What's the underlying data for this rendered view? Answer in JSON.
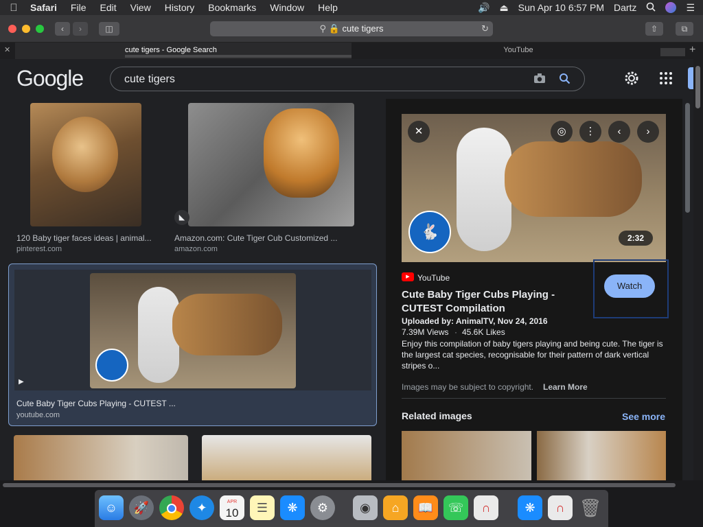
{
  "menubar": {
    "app": "Safari",
    "items": [
      "File",
      "Edit",
      "View",
      "History",
      "Bookmarks",
      "Window",
      "Help"
    ],
    "datetime": "Sun Apr 10  6:57 PM",
    "user": "Dartz"
  },
  "toolbar": {
    "url": "cute tigers"
  },
  "tabs": [
    {
      "label": "cute tigers - Google Search"
    },
    {
      "label": "YouTube"
    }
  ],
  "google": {
    "logo": "Google",
    "query": "cute tigers"
  },
  "results": [
    {
      "caption": "120 Baby tiger faces ideas | animal...",
      "source": "pinterest.com"
    },
    {
      "caption": "Amazon.com: Cute Tiger Cub Customized ...",
      "source": "amazon.com"
    },
    {
      "caption": "Cute Baby Tiger Cubs Playing - CUTEST ...",
      "source": "youtube.com"
    }
  ],
  "preview": {
    "duration": "2:32",
    "platform": "YouTube",
    "title": "Cute Baby Tiger Cubs Playing - CUTEST Compilation",
    "uploaded": "Uploaded by: AnimalTV, Nov 24, 2016",
    "views": "7.39M Views",
    "likes": "45.6K Likes",
    "description": "Enjoy this compilation of baby tigers playing and being cute. The tiger is the largest cat species, recognisable for their pattern of dark vertical stripes o...",
    "copyright": "Images may be subject to copyright.",
    "learn_more": "Learn More",
    "watch_label": "Watch",
    "related_title": "Related images",
    "see_more": "See more"
  },
  "dock": {
    "calendar_month": "APR",
    "calendar_day": "10"
  },
  "colors": {
    "accent": "#8ab4f8",
    "background": "#202124",
    "selected_border": "#7f9fcf"
  }
}
